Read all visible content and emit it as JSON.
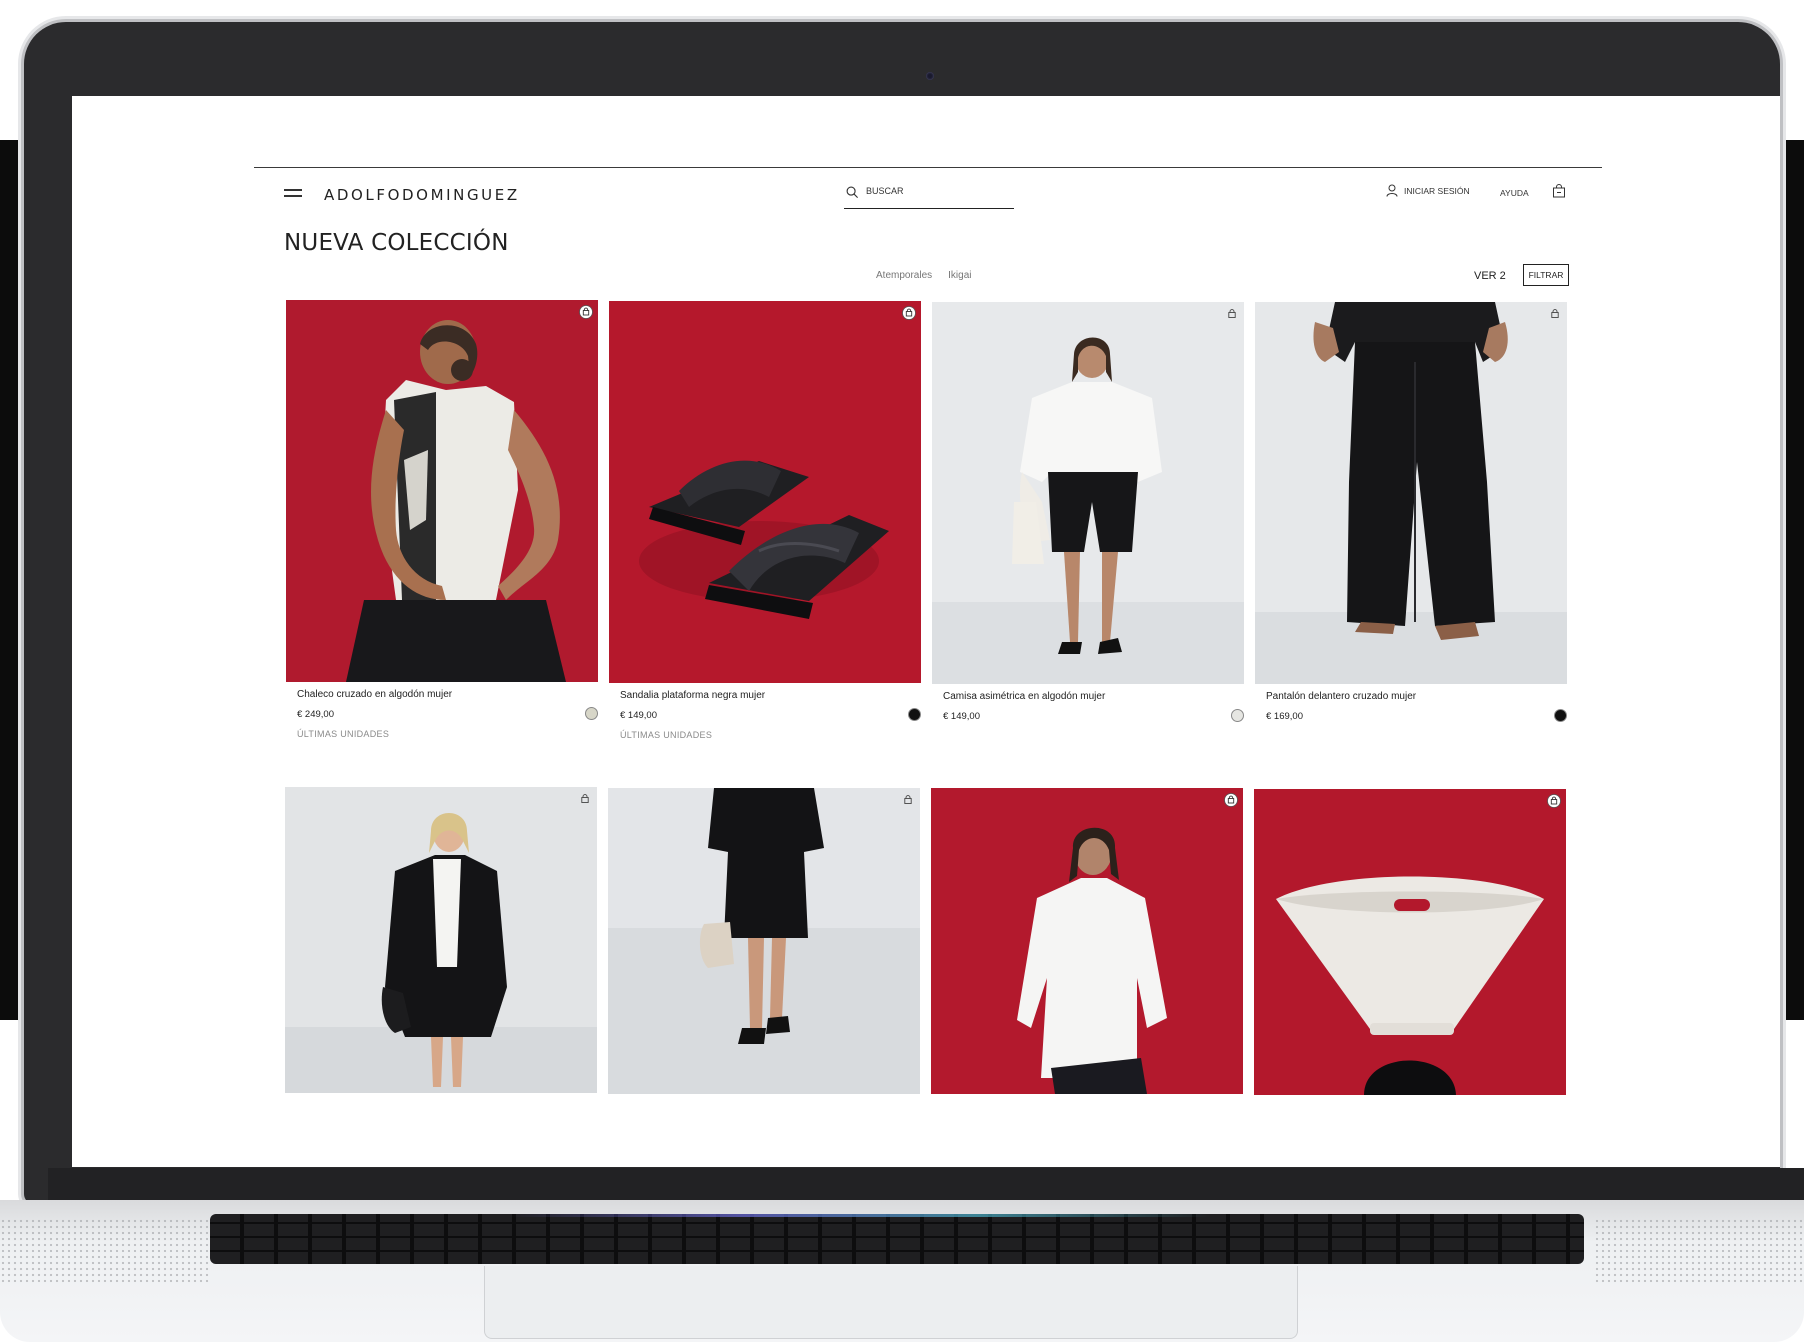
{
  "site": {
    "logo": "ADOLFODOMINGUEZ",
    "search_placeholder": "BUSCAR",
    "login": "INICIAR SESIÓN",
    "help": "AYUDA"
  },
  "listing": {
    "title": "NUEVA COLECCIÓN",
    "tabs": [
      "Atemporales",
      "Ikigai"
    ],
    "view_toggle": "VER 2",
    "filter": "FILTRAR"
  },
  "products": [
    {
      "name": "Chaleco cruzado en algodón mujer",
      "price": "€ 249,00",
      "stock": "ÚLTIMAS UNIDADES",
      "swatch": "#d7d6c8"
    },
    {
      "name": "Sandalia plataforma negra mujer",
      "price": "€ 149,00",
      "stock": "ÚLTIMAS UNIDADES",
      "swatch": "#111111"
    },
    {
      "name": "Camisa asimétrica en algodón mujer",
      "price": "€ 149,00",
      "stock": "",
      "swatch": "#e6e6e2"
    },
    {
      "name": "Pantalón delantero cruzado mujer",
      "price": "€ 169,00",
      "stock": "",
      "swatch": "#111111"
    }
  ],
  "colors": {
    "accent_red": "#b01a2e",
    "studio_gray": "#e4e6e8"
  }
}
